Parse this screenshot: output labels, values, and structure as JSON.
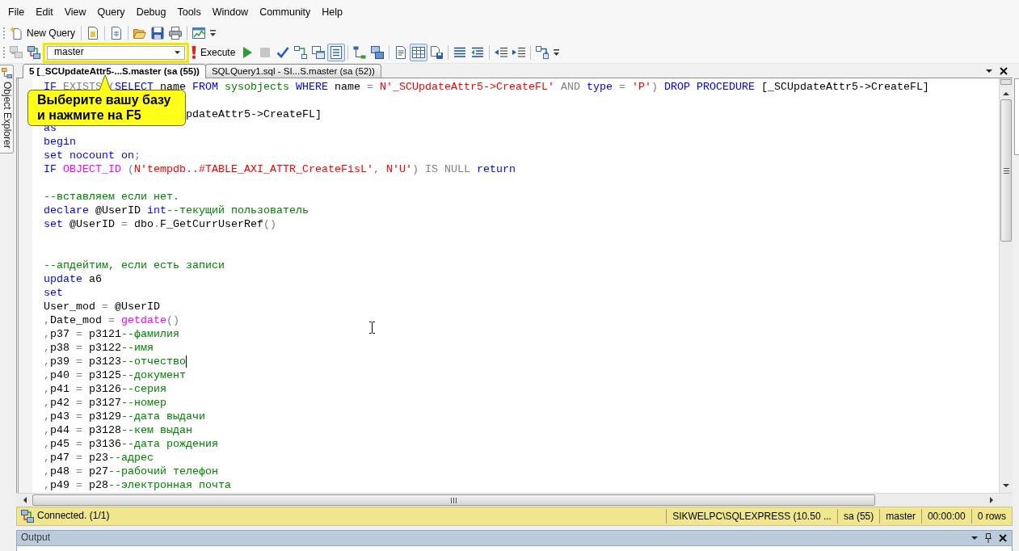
{
  "menu": [
    "File",
    "Edit",
    "View",
    "Query",
    "Debug",
    "Tools",
    "Window",
    "Community",
    "Help"
  ],
  "toolbars": [
    {
      "items": [
        {
          "kind": "labeled",
          "label": "New Query",
          "disabled": false,
          "pressed": false
        },
        {
          "kind": "separator"
        },
        {
          "kind": "icon",
          "disabled": false,
          "pressed": false
        },
        {
          "kind": "separator"
        },
        {
          "kind": "icon",
          "disabled": false,
          "pressed": false
        },
        {
          "kind": "separator"
        },
        {
          "kind": "icon",
          "disabled": false,
          "pressed": false
        },
        {
          "kind": "icon",
          "disabled": false,
          "pressed": false
        },
        {
          "kind": "icon",
          "disabled": false,
          "pressed": false
        },
        {
          "kind": "separator"
        },
        {
          "kind": "icon",
          "disabled": false,
          "pressed": false
        },
        {
          "kind": "overflow"
        }
      ]
    },
    {
      "items": [
        {
          "kind": "icon",
          "disabled": true,
          "pressed": false
        },
        {
          "kind": "icon",
          "disabled": false,
          "pressed": false
        },
        {
          "kind": "combo",
          "value": "master",
          "highlighted": true
        },
        {
          "kind": "labeled",
          "label": "Execute",
          "disabled": false,
          "pressed": false
        },
        {
          "kind": "icon",
          "disabled": false,
          "pressed": false
        },
        {
          "kind": "icon",
          "disabled": true,
          "pressed": false
        },
        {
          "kind": "icon",
          "disabled": false,
          "pressed": false
        },
        {
          "kind": "icon",
          "disabled": false,
          "pressed": false
        },
        {
          "kind": "icon",
          "disabled": false,
          "pressed": false
        },
        {
          "kind": "icon",
          "disabled": false,
          "pressed": true
        },
        {
          "kind": "separator"
        },
        {
          "kind": "icon",
          "disabled": false,
          "pressed": false
        },
        {
          "kind": "icon",
          "disabled": false,
          "pressed": false
        },
        {
          "kind": "separator"
        },
        {
          "kind": "icon",
          "disabled": false,
          "pressed": false
        },
        {
          "kind": "icon",
          "disabled": false,
          "pressed": true
        },
        {
          "kind": "icon",
          "disabled": false,
          "pressed": false
        },
        {
          "kind": "separator"
        },
        {
          "kind": "icon",
          "disabled": false,
          "pressed": false
        },
        {
          "kind": "icon",
          "disabled": false,
          "pressed": false
        },
        {
          "kind": "separator"
        },
        {
          "kind": "icon",
          "disabled": false,
          "pressed": false
        },
        {
          "kind": "icon",
          "disabled": false,
          "pressed": false
        },
        {
          "kind": "separator"
        },
        {
          "kind": "icon",
          "disabled": false,
          "pressed": false
        },
        {
          "kind": "overflow"
        }
      ]
    }
  ],
  "document_tabs": [
    {
      "label": "5 [_SCUpdateAttr5-...S.master (sa (55))",
      "selected": true
    },
    {
      "label": "SQLQuery1.sql - SI...S.master (sa (52))",
      "selected": false
    }
  ],
  "left_dock_tab": "Object Explorer",
  "editor": {
    "lines": [
      {
        "kind": "code",
        "caret": false,
        "tokens": [
          {
            "kind": "keyword",
            "text": "IF "
          },
          {
            "kind": "operator",
            "text": "EXISTS "
          },
          {
            "kind": "operator",
            "text": "("
          },
          {
            "kind": "keyword",
            "text": "SELECT"
          },
          {
            "kind": "plain",
            "text": " name "
          },
          {
            "kind": "keyword",
            "text": "FROM "
          },
          {
            "kind": "system",
            "text": "sysobjects "
          },
          {
            "kind": "keyword",
            "text": "WHERE"
          },
          {
            "kind": "plain",
            "text": " name "
          },
          {
            "kind": "operator",
            "text": "= "
          },
          {
            "kind": "string",
            "text": "N'_SCUpdateAttr5->CreateFL' "
          },
          {
            "kind": "operator",
            "text": "AND "
          },
          {
            "kind": "keyword",
            "text": "type "
          },
          {
            "kind": "operator",
            "text": "= "
          },
          {
            "kind": "string",
            "text": "'P'"
          },
          {
            "kind": "operator",
            "text": ") "
          },
          {
            "kind": "keyword",
            "text": "DROP PROCEDURE"
          },
          {
            "kind": "plain",
            "text": " [_SCUpdateAttr5->CreateFL]"
          }
        ]
      },
      {
        "kind": "blank"
      },
      {
        "kind": "covered",
        "caret": false,
        "tokens": [
          {
            "kind": "plain",
            "text": "pdateAttr5->CreateFL]"
          }
        ]
      },
      {
        "kind": "code",
        "caret": false,
        "tokens": [
          {
            "kind": "keyword",
            "text": "as"
          }
        ]
      },
      {
        "kind": "code",
        "caret": false,
        "tokens": [
          {
            "kind": "keyword",
            "text": "begin"
          }
        ]
      },
      {
        "kind": "code",
        "caret": false,
        "tokens": [
          {
            "kind": "keyword",
            "text": "set nocount on"
          },
          {
            "kind": "operator",
            "text": ";"
          }
        ]
      },
      {
        "kind": "code",
        "caret": false,
        "tokens": [
          {
            "kind": "keyword",
            "text": "IF "
          },
          {
            "kind": "function",
            "text": "OBJECT_ID "
          },
          {
            "kind": "operator",
            "text": "("
          },
          {
            "kind": "string",
            "text": "N'tempdb..#TABLE_AXI_ATTR_CreateFisL'"
          },
          {
            "kind": "operator",
            "text": ", "
          },
          {
            "kind": "string",
            "text": "N'U'"
          },
          {
            "kind": "operator",
            "text": ") IS NULL "
          },
          {
            "kind": "keyword",
            "text": "return"
          }
        ]
      },
      {
        "kind": "blank"
      },
      {
        "kind": "code",
        "caret": false,
        "tokens": [
          {
            "kind": "comment",
            "text": "--вставляем если нет."
          }
        ]
      },
      {
        "kind": "code",
        "caret": false,
        "tokens": [
          {
            "kind": "keyword",
            "text": "declare"
          },
          {
            "kind": "plain",
            "text": " @UserID "
          },
          {
            "kind": "keyword",
            "text": "int"
          },
          {
            "kind": "comment",
            "text": "--текущий пользователь"
          }
        ]
      },
      {
        "kind": "code",
        "caret": false,
        "tokens": [
          {
            "kind": "keyword",
            "text": "set"
          },
          {
            "kind": "plain",
            "text": " @UserID "
          },
          {
            "kind": "operator",
            "text": "="
          },
          {
            "kind": "plain",
            "text": " dbo"
          },
          {
            "kind": "operator",
            "text": "."
          },
          {
            "kind": "plain",
            "text": "F_GetCurrUserRef"
          },
          {
            "kind": "operator",
            "text": "()"
          }
        ]
      },
      {
        "kind": "blank"
      },
      {
        "kind": "blank"
      },
      {
        "kind": "code",
        "caret": false,
        "tokens": [
          {
            "kind": "comment",
            "text": "--апдейтим, если есть записи"
          }
        ]
      },
      {
        "kind": "code",
        "caret": false,
        "tokens": [
          {
            "kind": "keyword",
            "text": "update"
          },
          {
            "kind": "plain",
            "text": " a6"
          }
        ]
      },
      {
        "kind": "code",
        "caret": false,
        "tokens": [
          {
            "kind": "keyword",
            "text": "set"
          }
        ]
      },
      {
        "kind": "code",
        "caret": false,
        "tokens": [
          {
            "kind": "plain",
            "text": "User_mod "
          },
          {
            "kind": "operator",
            "text": "="
          },
          {
            "kind": "plain",
            "text": " @UserID"
          }
        ]
      },
      {
        "kind": "code",
        "caret": false,
        "tokens": [
          {
            "kind": "operator",
            "text": ","
          },
          {
            "kind": "plain",
            "text": "Date_mod "
          },
          {
            "kind": "operator",
            "text": "= "
          },
          {
            "kind": "function",
            "text": "getdate"
          },
          {
            "kind": "operator",
            "text": "()"
          }
        ]
      },
      {
        "kind": "code",
        "caret": false,
        "tokens": [
          {
            "kind": "operator",
            "text": ","
          },
          {
            "kind": "plain",
            "text": "p37 "
          },
          {
            "kind": "operator",
            "text": "="
          },
          {
            "kind": "plain",
            "text": " p3121"
          },
          {
            "kind": "comment",
            "text": "--фамилия"
          }
        ]
      },
      {
        "kind": "code",
        "caret": false,
        "tokens": [
          {
            "kind": "operator",
            "text": ","
          },
          {
            "kind": "plain",
            "text": "p38 "
          },
          {
            "kind": "operator",
            "text": "="
          },
          {
            "kind": "plain",
            "text": " p3122"
          },
          {
            "kind": "comment",
            "text": "--имя"
          }
        ]
      },
      {
        "kind": "code",
        "caret": true,
        "tokens": [
          {
            "kind": "operator",
            "text": ","
          },
          {
            "kind": "plain",
            "text": "p39 "
          },
          {
            "kind": "operator",
            "text": "="
          },
          {
            "kind": "plain",
            "text": " p3123"
          },
          {
            "kind": "comment",
            "text": "--отчество"
          }
        ]
      },
      {
        "kind": "code",
        "caret": false,
        "tokens": [
          {
            "kind": "operator",
            "text": ","
          },
          {
            "kind": "plain",
            "text": "p40 "
          },
          {
            "kind": "operator",
            "text": "="
          },
          {
            "kind": "plain",
            "text": " p3125"
          },
          {
            "kind": "comment",
            "text": "--документ"
          }
        ]
      },
      {
        "kind": "code",
        "caret": false,
        "tokens": [
          {
            "kind": "operator",
            "text": ","
          },
          {
            "kind": "plain",
            "text": "p41 "
          },
          {
            "kind": "operator",
            "text": "="
          },
          {
            "kind": "plain",
            "text": " p3126"
          },
          {
            "kind": "comment",
            "text": "--серия"
          }
        ]
      },
      {
        "kind": "code",
        "caret": false,
        "tokens": [
          {
            "kind": "operator",
            "text": ","
          },
          {
            "kind": "plain",
            "text": "p42 "
          },
          {
            "kind": "operator",
            "text": "="
          },
          {
            "kind": "plain",
            "text": " p3127"
          },
          {
            "kind": "comment",
            "text": "--номер"
          }
        ]
      },
      {
        "kind": "code",
        "caret": false,
        "tokens": [
          {
            "kind": "operator",
            "text": ","
          },
          {
            "kind": "plain",
            "text": "p43 "
          },
          {
            "kind": "operator",
            "text": "="
          },
          {
            "kind": "plain",
            "text": " p3129"
          },
          {
            "kind": "comment",
            "text": "--дата выдачи"
          }
        ]
      },
      {
        "kind": "code",
        "caret": false,
        "tokens": [
          {
            "kind": "operator",
            "text": ","
          },
          {
            "kind": "plain",
            "text": "p44 "
          },
          {
            "kind": "operator",
            "text": "="
          },
          {
            "kind": "plain",
            "text": " p3128"
          },
          {
            "kind": "comment",
            "text": "--кем выдан"
          }
        ]
      },
      {
        "kind": "code",
        "caret": false,
        "tokens": [
          {
            "kind": "operator",
            "text": ","
          },
          {
            "kind": "plain",
            "text": "p45 "
          },
          {
            "kind": "operator",
            "text": "="
          },
          {
            "kind": "plain",
            "text": " p3136"
          },
          {
            "kind": "comment",
            "text": "--дата рождения"
          }
        ]
      },
      {
        "kind": "code",
        "caret": false,
        "tokens": [
          {
            "kind": "operator",
            "text": ","
          },
          {
            "kind": "plain",
            "text": "p47 "
          },
          {
            "kind": "operator",
            "text": "="
          },
          {
            "kind": "plain",
            "text": " p23"
          },
          {
            "kind": "comment",
            "text": "--адрес"
          }
        ]
      },
      {
        "kind": "code",
        "caret": false,
        "tokens": [
          {
            "kind": "operator",
            "text": ","
          },
          {
            "kind": "plain",
            "text": "p48 "
          },
          {
            "kind": "operator",
            "text": "="
          },
          {
            "kind": "plain",
            "text": " p27"
          },
          {
            "kind": "comment",
            "text": "--рабочий телефон"
          }
        ]
      },
      {
        "kind": "code",
        "caret": false,
        "tokens": [
          {
            "kind": "operator",
            "text": ","
          },
          {
            "kind": "plain",
            "text": "p49 "
          },
          {
            "kind": "operator",
            "text": "="
          },
          {
            "kind": "plain",
            "text": " p28"
          },
          {
            "kind": "comment",
            "text": "--электронная почта"
          }
        ]
      }
    ]
  },
  "status_bar": {
    "message": "Connected. (1/1)",
    "panels": [
      "SIKWELPC\\SQLEXPRESS (10.50 ...",
      "sa (55)",
      "master",
      "00:00:00",
      "0 rows"
    ]
  },
  "output_panel": {
    "title": "Output"
  },
  "annotation": {
    "callout": [
      "Выберите вашу базу",
      "и нажмите на F5"
    ]
  }
}
